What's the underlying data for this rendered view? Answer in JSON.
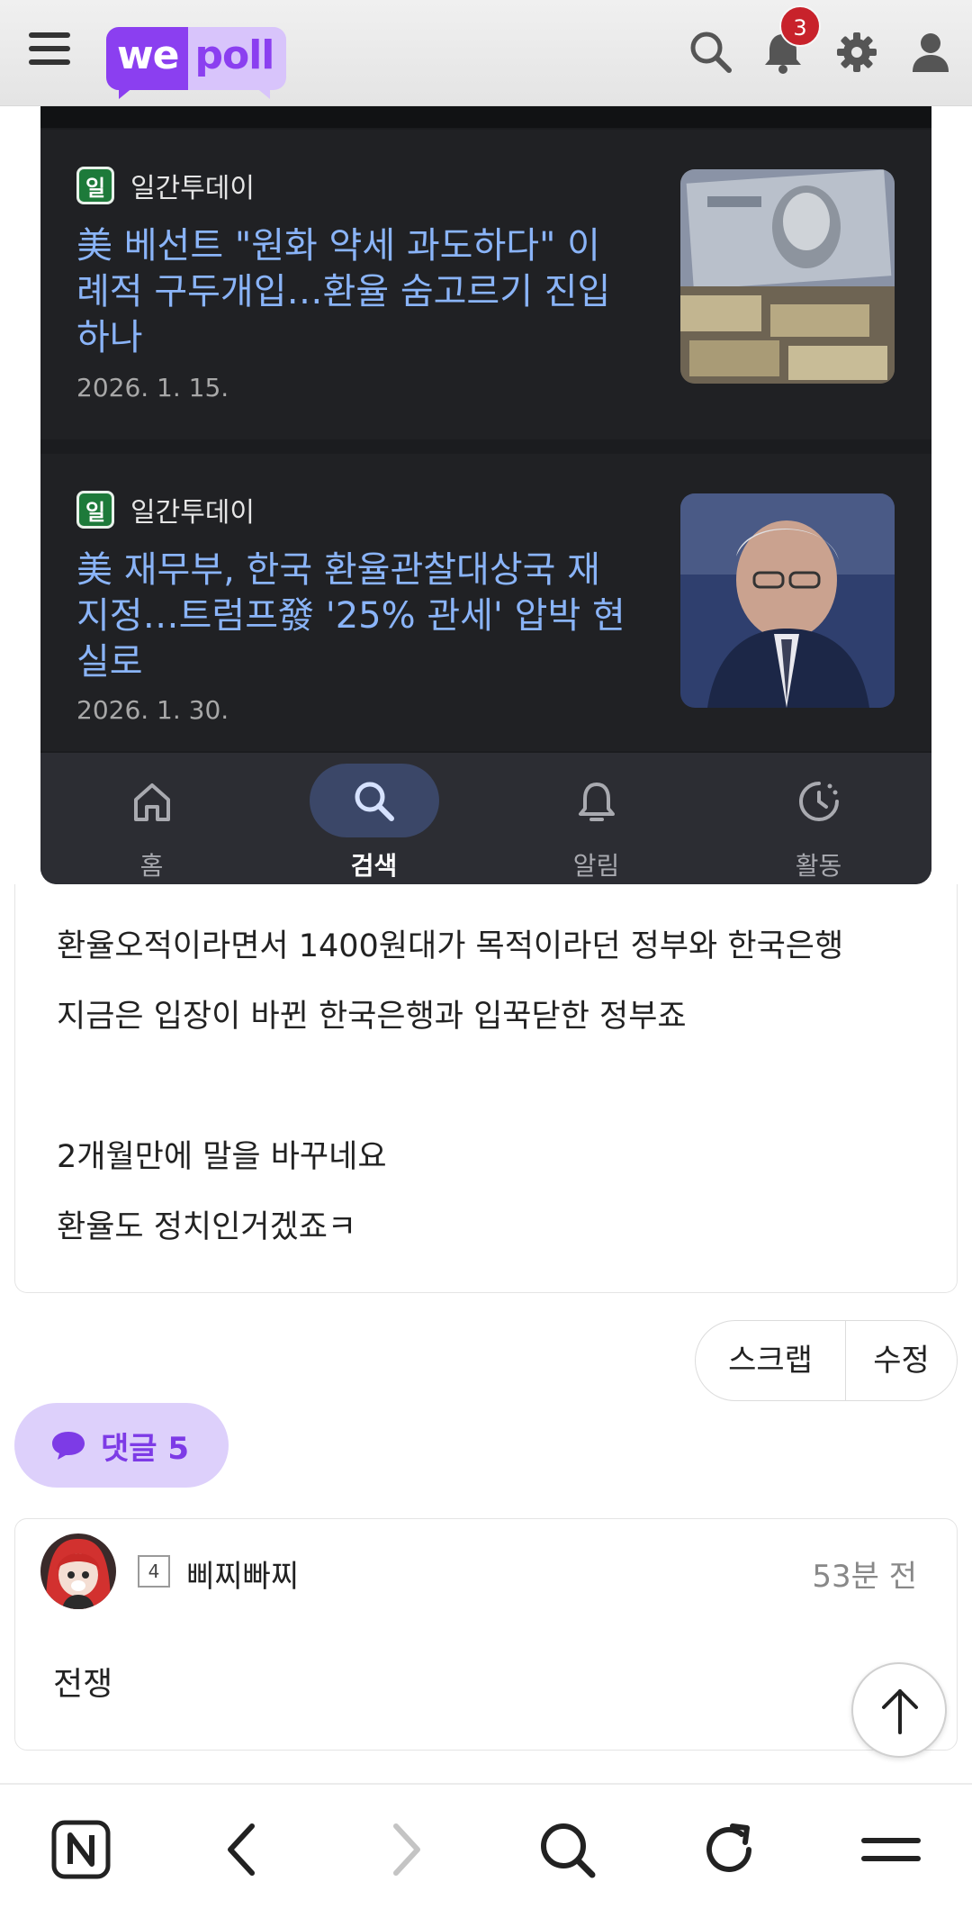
{
  "header": {
    "logo_we": "we",
    "logo_poll": "poll",
    "notification_count": "3",
    "icons": [
      "menu-icon",
      "search-icon",
      "bell-icon",
      "gear-icon",
      "user-icon"
    ]
  },
  "embedded_screenshot": {
    "news": [
      {
        "source_logo": "일",
        "source": "일간투데이",
        "headline_lines": [
          "美 베선트 \"원화 약세 과도하다\" 이",
          "례적 구두개입…환율 숨고르기 진입",
          "하나"
        ],
        "date": "2026. 1. 15."
      },
      {
        "source_logo": "일",
        "source": "일간투데이",
        "headline_lines": [
          "美 재무부, 한국 환율관찰대상국 재",
          "지정…트럼프發 '25% 관세' 압박 현",
          "실로"
        ],
        "date": "2026. 1. 30."
      }
    ],
    "nav": [
      {
        "label": "홈",
        "icon": "home-icon",
        "active": false
      },
      {
        "label": "검색",
        "icon": "search-icon",
        "active": true
      },
      {
        "label": "알림",
        "icon": "bell-icon",
        "active": false
      },
      {
        "label": "활동",
        "icon": "activity-icon",
        "active": false
      }
    ]
  },
  "post": {
    "lines": [
      "환율오적이라면서 1400원대가 목적이라던 정부와 한국은행",
      "지금은 입장이 바뀐 한국은행과 입꾹닫한 정부죠",
      "",
      "2개월만에 말을 바꾸네요",
      "환율도 정치인거겠죠ㅋ"
    ]
  },
  "actions": {
    "scrap": "스크랩",
    "edit": "수정"
  },
  "comments": {
    "header_label": "댓글 5",
    "items": [
      {
        "level": "4",
        "nickname": "삐찌빠찌",
        "time": "53분 전",
        "text": "전쟁"
      }
    ]
  },
  "browser_bar": {
    "icons": [
      "naver-home-icon",
      "back-icon",
      "forward-icon",
      "search-icon",
      "refresh-icon",
      "menu-icon"
    ]
  },
  "colors": {
    "brand": "#8b3ff0",
    "brand_light": "#d8c4fb",
    "badge": "#c8222b",
    "link_blue": "#8ab4f8",
    "dark_bg": "#202124"
  }
}
